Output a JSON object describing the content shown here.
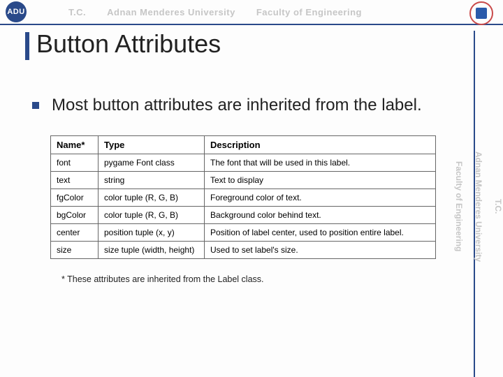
{
  "watermark": {
    "top_left_logo": "ADU",
    "top_tc": "T.C.",
    "top_univ": "Adnan Menderes University",
    "top_faculty": "Faculty of Engineering",
    "right_tc": "T.C.",
    "right_univ": "Adnan Menderes University",
    "right_faculty": "Faculty of Engineering"
  },
  "title": "Button Attributes",
  "bullet": "Most button attributes are inherited from the label.",
  "table": {
    "headers": {
      "name": "Name*",
      "type": "Type",
      "desc": "Description"
    },
    "rows": [
      {
        "name": "font",
        "type": "pygame Font class",
        "desc": "The font that will be used in this label."
      },
      {
        "name": "text",
        "type": "string",
        "desc": "Text to display"
      },
      {
        "name": "fgColor",
        "type": "color tuple (R, G, B)",
        "desc": "Foreground color of text."
      },
      {
        "name": "bgColor",
        "type": "color tuple (R, G, B)",
        "desc": "Background color behind text."
      },
      {
        "name": "center",
        "type": "position tuple (x, y)",
        "desc": "Position of label center, used to position entire label."
      },
      {
        "name": "size",
        "type": "size tuple (width, height)",
        "desc": "Used to set label's size."
      }
    ]
  },
  "footnote": "* These attributes are inherited from the Label class."
}
